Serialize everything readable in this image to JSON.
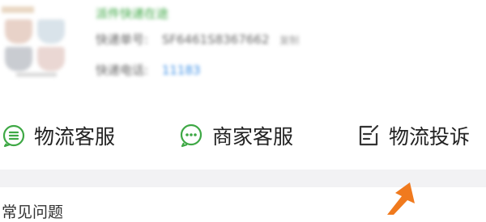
{
  "package": {
    "status": "派件快递在途",
    "tracking_label": "快递单号:",
    "tracking_number": "SF6461S8367662",
    "copy_label": "复制",
    "phone_label": "快递电话:",
    "phone_number": "11183"
  },
  "actions": [
    {
      "label": "物流客服",
      "icon": "chat-list-icon"
    },
    {
      "label": "商家客服",
      "icon": "chat-dots-icon"
    },
    {
      "label": "物流投诉",
      "icon": "edit-note-icon"
    }
  ],
  "faq": {
    "title": "常见问题"
  },
  "colors": {
    "accent_green": "#3ea845",
    "arrow_orange": "#f07a1e",
    "divider": "#f2f2f4"
  }
}
